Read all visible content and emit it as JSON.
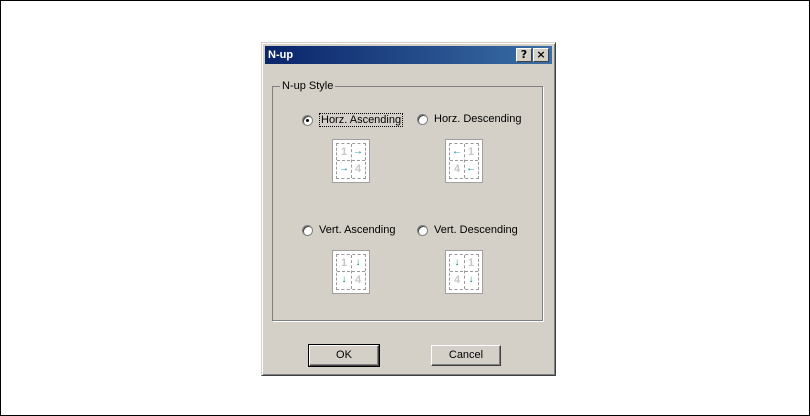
{
  "dialog": {
    "title": "N-up",
    "help_label": "?",
    "close_label": "×"
  },
  "group": {
    "label": "N-up Style"
  },
  "options": [
    {
      "label": "Horz. Ascending",
      "selected": true,
      "cells": [
        "1",
        "→",
        "→",
        "4"
      ]
    },
    {
      "label": "Horz. Descending",
      "selected": false,
      "cells": [
        "←",
        "1",
        "4",
        "←"
      ]
    },
    {
      "label": "Vert. Ascending",
      "selected": false,
      "cells": [
        "1",
        "↓",
        "↓",
        "4"
      ]
    },
    {
      "label": "Vert. Descending",
      "selected": false,
      "cells": [
        "↓",
        "1",
        "4",
        "↓"
      ]
    }
  ],
  "buttons": {
    "ok": "OK",
    "cancel": "Cancel"
  },
  "colors": {
    "titlebar": "#0a246a",
    "arrow": "#00868a",
    "face": "#d4d0c8"
  }
}
